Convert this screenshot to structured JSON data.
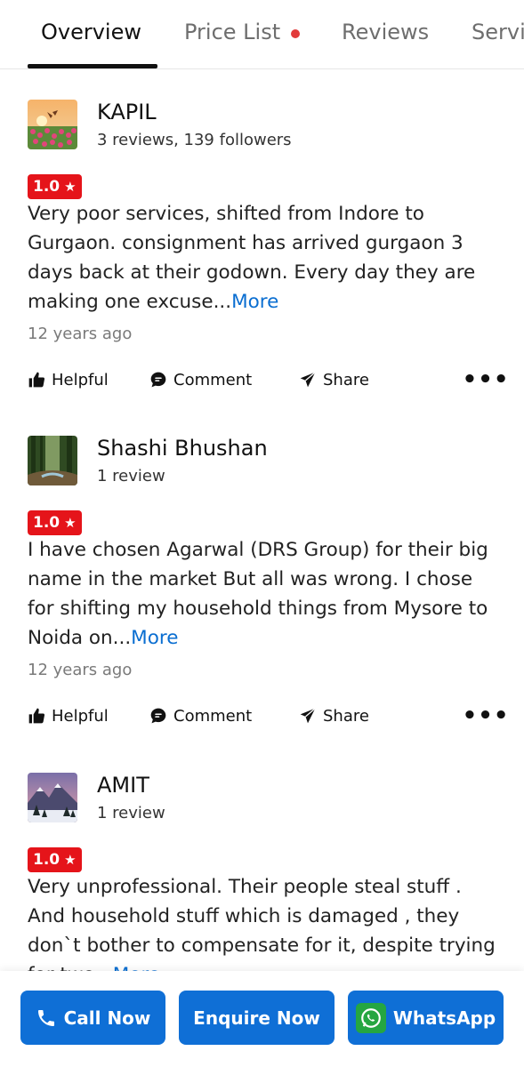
{
  "tabs": [
    {
      "label": "Overview",
      "active": true
    },
    {
      "label": "Price List",
      "has_dot": true
    },
    {
      "label": "Reviews"
    },
    {
      "label": "Servi"
    }
  ],
  "reviews": [
    {
      "author": "KAPIL",
      "meta": "3 reviews, 139 followers",
      "rating": "1.0",
      "text": "Very poor services, shifted from Indore to Gurgaon. consignment has arrived gurgaon 3 days back at their godown. Every day they are making one excuse...",
      "more": "More",
      "time": "12 years ago"
    },
    {
      "author": "Shashi Bhushan",
      "meta": "1 review",
      "rating": "1.0",
      "text": "I have chosen Agarwal (DRS Group) for their big name in the market But all was wrong. I chose for shifting my household things from Mysore to Noida on...",
      "more": "More",
      "time": "12 years ago"
    },
    {
      "author": "AMIT",
      "meta": "1 review",
      "rating": "1.0",
      "text": "Very unprofessional. Their people steal stuff . And household stuff which is damaged , they don`t bother to compensate for it, despite trying for two...",
      "more": "More",
      "time": ""
    }
  ],
  "actions": {
    "helpful": "Helpful",
    "comment": "Comment",
    "share": "Share",
    "more_options": "•••"
  },
  "bottom_bar": {
    "call": "Call Now",
    "enquire": "Enquire Now",
    "whatsapp": "WhatsApp"
  },
  "colors": {
    "accent": "#0f6fd6",
    "rating": "#e5141a",
    "link": "#0a6ed1",
    "whatsapp": "#25a641"
  }
}
